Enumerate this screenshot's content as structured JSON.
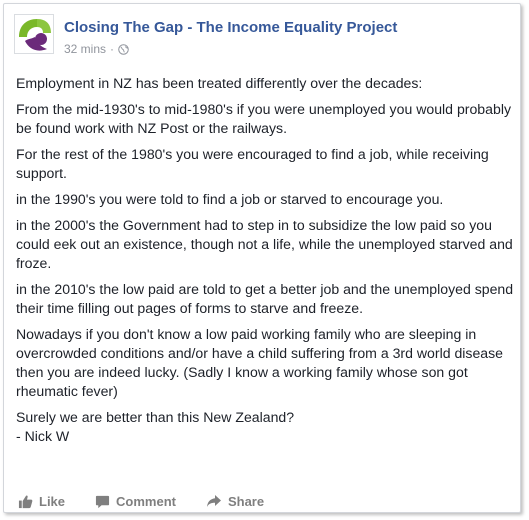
{
  "post": {
    "page_name": "Closing The Gap - The Income Equality Project",
    "time": "32 mins",
    "separator": "·",
    "paragraphs": [
      "Employment in NZ has been treated differently over the decades:",
      "From the mid-1930's to mid-1980's if you were unemployed you would probably be found work with NZ Post or the railways.",
      "For the rest of the 1980's you were encouraged to find a job, while receiving support.",
      "in the 1990's you were told to find a job or starved to encourage you.",
      "in the 2000's the Government had to step in to subsidize the low paid so you could eek out an existence, though not a life, while the unemployed starved and froze.",
      "in the 2010's the low paid are told to get a better job and the unemployed spend their time filling out pages of forms to starve and freeze.",
      "Nowadays if you don't know a low paid working family who are sleeping in overcrowded conditions and/or have a child suffering from a 3rd world disease then you are indeed lucky. (Sadly I know a working family whose son got rheumatic fever)"
    ],
    "closing_line": "Surely we are better than this New Zealand?",
    "signature": "- Nick W"
  },
  "actions": {
    "like_label": "Like",
    "comment_label": "Comment",
    "share_label": "Share"
  },
  "colors": {
    "page_name": "#365899",
    "logo_green": "#7ab829",
    "logo_purple": "#6b2a7a"
  },
  "icons": [
    "avatar-logo",
    "globe-icon",
    "like-icon",
    "comment-icon",
    "share-icon"
  ]
}
